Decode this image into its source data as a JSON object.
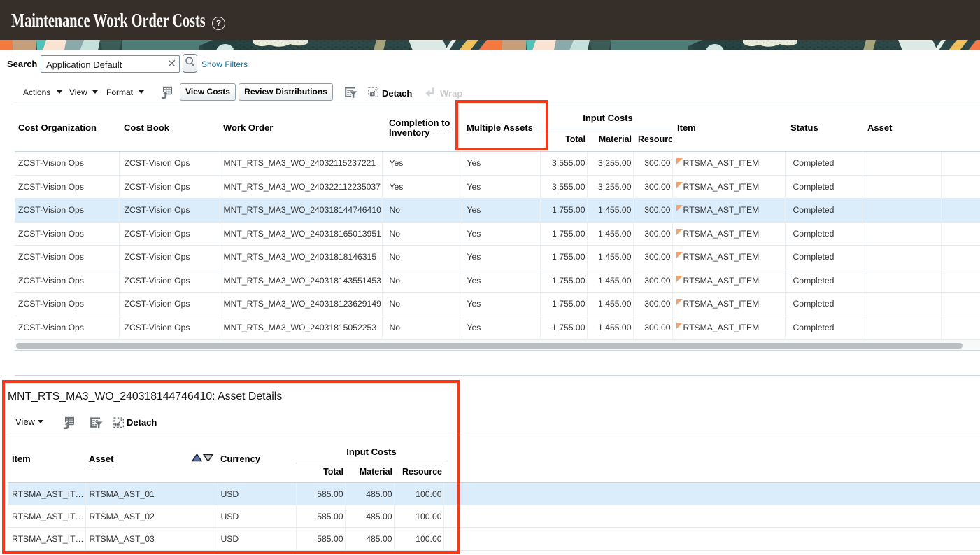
{
  "page": {
    "title": "Maintenance Work Order Costs",
    "help_icon_glyph": "?"
  },
  "search": {
    "label": "Search",
    "value": "Application Default",
    "show_filters_link": "Show Filters"
  },
  "toolbar": {
    "menus": {
      "actions": "Actions",
      "view": "View",
      "format": "Format"
    },
    "view_costs_button": "View Costs",
    "review_distributions_button": "Review Distributions",
    "detach_label": "Detach",
    "wrap_label": "Wrap"
  },
  "table1": {
    "headers": {
      "cost_organization": "Cost Organization",
      "cost_book": "Cost Book",
      "work_order": "Work Order",
      "completion_line1": "Completion to",
      "completion_line2": "Inventory",
      "multiple_assets": "Multiple Assets",
      "input_costs_group": "Input Costs",
      "total": "Total",
      "material": "Material",
      "resource": "Resource",
      "item": "Item",
      "status": "Status",
      "asset": "Asset"
    },
    "selected_row_index": 2,
    "rows": [
      {
        "cost_organization": "ZCST-Vision Ops",
        "cost_book": "ZCST-Vision Ops",
        "work_order": "MNT_RTS_MA3_WO_24032115237221",
        "completion_to_inventory": "Yes",
        "multiple_assets": "Yes",
        "total": "3,555.00",
        "material": "3,255.00",
        "resource": "300.00",
        "item": "RTSMA_AST_ITEM",
        "status": "Completed",
        "asset": ""
      },
      {
        "cost_organization": "ZCST-Vision Ops",
        "cost_book": "ZCST-Vision Ops",
        "work_order": "MNT_RTS_MA3_WO_240322112235037",
        "completion_to_inventory": "Yes",
        "multiple_assets": "Yes",
        "total": "3,555.00",
        "material": "3,255.00",
        "resource": "300.00",
        "item": "RTSMA_AST_ITEM",
        "status": "Completed",
        "asset": ""
      },
      {
        "cost_organization": "ZCST-Vision Ops",
        "cost_book": "ZCST-Vision Ops",
        "work_order": "MNT_RTS_MA3_WO_240318144746410",
        "completion_to_inventory": "No",
        "multiple_assets": "Yes",
        "total": "1,755.00",
        "material": "1,455.00",
        "resource": "300.00",
        "item": "RTSMA_AST_ITEM",
        "status": "Completed",
        "asset": ""
      },
      {
        "cost_organization": "ZCST-Vision Ops",
        "cost_book": "ZCST-Vision Ops",
        "work_order": "MNT_RTS_MA3_WO_240318165013951",
        "completion_to_inventory": "No",
        "multiple_assets": "Yes",
        "total": "1,755.00",
        "material": "1,455.00",
        "resource": "300.00",
        "item": "RTSMA_AST_ITEM",
        "status": "Completed",
        "asset": ""
      },
      {
        "cost_organization": "ZCST-Vision Ops",
        "cost_book": "ZCST-Vision Ops",
        "work_order": "MNT_RTS_MA3_WO_24031818146315",
        "completion_to_inventory": "No",
        "multiple_assets": "Yes",
        "total": "1,755.00",
        "material": "1,455.00",
        "resource": "300.00",
        "item": "RTSMA_AST_ITEM",
        "status": "Completed",
        "asset": ""
      },
      {
        "cost_organization": "ZCST-Vision Ops",
        "cost_book": "ZCST-Vision Ops",
        "work_order": "MNT_RTS_MA3_WO_240318143551453",
        "completion_to_inventory": "No",
        "multiple_assets": "Yes",
        "total": "1,755.00",
        "material": "1,455.00",
        "resource": "300.00",
        "item": "RTSMA_AST_ITEM",
        "status": "Completed",
        "asset": ""
      },
      {
        "cost_organization": "ZCST-Vision Ops",
        "cost_book": "ZCST-Vision Ops",
        "work_order": "MNT_RTS_MA3_WO_240318123629149",
        "completion_to_inventory": "No",
        "multiple_assets": "Yes",
        "total": "1,755.00",
        "material": "1,455.00",
        "resource": "300.00",
        "item": "RTSMA_AST_ITEM",
        "status": "Completed",
        "asset": ""
      },
      {
        "cost_organization": "ZCST-Vision Ops",
        "cost_book": "ZCST-Vision Ops",
        "work_order": "MNT_RTS_MA3_WO_24031815052253",
        "completion_to_inventory": "No",
        "multiple_assets": "Yes",
        "total": "1,755.00",
        "material": "1,455.00",
        "resource": "300.00",
        "item": "RTSMA_AST_ITEM",
        "status": "Completed",
        "asset": ""
      }
    ]
  },
  "detail": {
    "title": "MNT_RTS_MA3_WO_240318144746410: Asset Details",
    "toolbar": {
      "view_menu": "View",
      "detach_label": "Detach"
    },
    "table": {
      "headers": {
        "item": "Item",
        "asset": "Asset",
        "currency": "Currency",
        "input_costs_group": "Input Costs",
        "total": "Total",
        "material": "Material",
        "resource": "Resource"
      },
      "selected_row_index": 0,
      "rows": [
        {
          "item": "RTSMA_AST_ITEM",
          "asset": "RTSMA_AST_01",
          "currency": "USD",
          "total": "585.00",
          "material": "485.00",
          "resource": "100.00"
        },
        {
          "item": "RTSMA_AST_ITEM",
          "asset": "RTSMA_AST_02",
          "currency": "USD",
          "total": "585.00",
          "material": "485.00",
          "resource": "100.00"
        },
        {
          "item": "RTSMA_AST_ITEM",
          "asset": "RTSMA_AST_03",
          "currency": "USD",
          "total": "585.00",
          "material": "485.00",
          "resource": "100.00"
        }
      ]
    }
  },
  "colors": {
    "header_background": "#362f29",
    "selected_row": "#dbecfa",
    "annotation_red": "#f03a20",
    "link_blue": "#176f96"
  }
}
